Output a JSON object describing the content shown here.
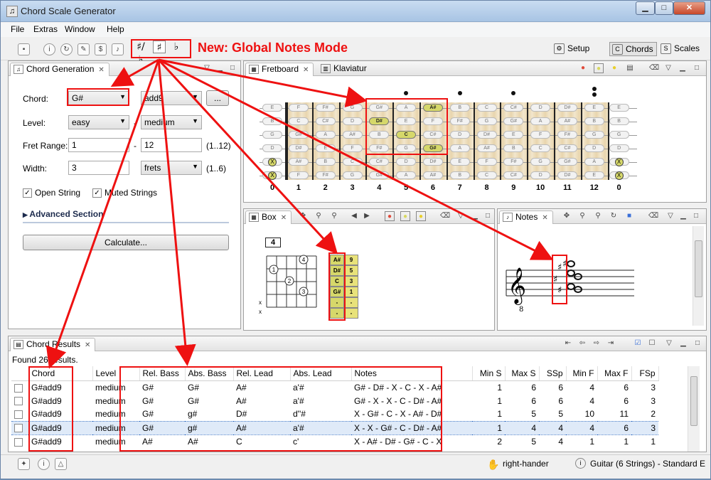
{
  "window": {
    "title": "Chord Scale Generator"
  },
  "menu": [
    "File",
    "Extras",
    "Window",
    "Help"
  ],
  "toolbar": {
    "notes_mode": {
      "sharp_flat": "♯/♭",
      "sharp": "♯",
      "flat": "♭",
      "active": "sharp"
    },
    "annotation": "New: Global Notes Mode"
  },
  "perspectives": [
    {
      "label": "Setup",
      "icon": "setup-icon",
      "active": false
    },
    {
      "label": "Chords",
      "icon": "chords-icon",
      "active": true
    },
    {
      "label": "Scales",
      "icon": "scales-icon",
      "active": false
    }
  ],
  "chord_generation": {
    "tab": "Chord Generation",
    "chord_label": "Chord:",
    "chord_root": "G#",
    "chord_type": "add9",
    "more_button": "...",
    "level_label": "Level:",
    "level_from": "easy",
    "level_dash": "-",
    "level_to": "medium",
    "fret_range_label": "Fret Range:",
    "fret_from": "1",
    "fret_dash": "-",
    "fret_to": "12",
    "fret_hint": "(1..12)",
    "width_label": "Width:",
    "width_value": "3",
    "width_unit": "frets",
    "width_hint": "(1..6)",
    "open_string": "Open String",
    "muted_strings": "Muted Strings",
    "advanced": "Advanced Section",
    "calculate": "Calculate..."
  },
  "fretboard": {
    "tabs": [
      "Fretboard",
      "Klaviatur"
    ],
    "strings": [
      [
        "E",
        "F",
        "F#",
        "G",
        "G#",
        "A",
        "A#",
        "B",
        "C",
        "C#",
        "D",
        "D#",
        "E"
      ],
      [
        "B",
        "C",
        "C#",
        "D",
        "D#",
        "E",
        "F",
        "F#",
        "G",
        "G#",
        "A",
        "A#",
        "B"
      ],
      [
        "G",
        "G#",
        "A",
        "A#",
        "B",
        "C",
        "C#",
        "D",
        "D#",
        "E",
        "F",
        "F#",
        "G"
      ],
      [
        "D",
        "D#",
        "E",
        "F",
        "F#",
        "G",
        "G#",
        "A",
        "A#",
        "B",
        "C",
        "C#",
        "D"
      ],
      [
        "A",
        "A#",
        "B",
        "C",
        "C#",
        "D",
        "D#",
        "E",
        "F",
        "F#",
        "G",
        "G#",
        "A"
      ],
      [
        "E",
        "F",
        "F#",
        "G",
        "G#",
        "A",
        "A#",
        "B",
        "C",
        "C#",
        "D",
        "D#",
        "E"
      ]
    ],
    "highlighted": [
      {
        "string": 0,
        "fret": 6,
        "note": "A#"
      },
      {
        "string": 1,
        "fret": 4,
        "note": "D#"
      },
      {
        "string": 2,
        "fret": 5,
        "note": "C"
      },
      {
        "string": 3,
        "fret": 6,
        "note": "G#"
      }
    ],
    "open_marks": [
      "X",
      "X"
    ],
    "fret_numbers": [
      "0",
      "1",
      "2",
      "3",
      "4",
      "5",
      "6",
      "7",
      "8",
      "9",
      "10",
      "11",
      "12",
      "0"
    ]
  },
  "box": {
    "tab": "Box",
    "start_fret": "4",
    "finger_labels": [
      "1",
      "2",
      "3",
      "4"
    ],
    "muted": [
      "x",
      "x"
    ],
    "note_table": [
      {
        "note": "A#",
        "interval": "9"
      },
      {
        "note": "D#",
        "interval": "5"
      },
      {
        "note": "C",
        "interval": "3"
      },
      {
        "note": "G#",
        "interval": "1"
      },
      {
        "note": "-",
        "interval": "-"
      },
      {
        "note": "-",
        "interval": "-"
      }
    ]
  },
  "notes_view": {
    "tab": "Notes",
    "clef": "𝄞",
    "clef_sub": "8"
  },
  "results": {
    "tab": "Chord Results",
    "found": "Found 26 results.",
    "columns": [
      "Chord",
      "Level",
      "Rel. Bass",
      "Abs. Bass",
      "Rel. Lead",
      "Abs. Lead",
      "Notes",
      "Min S",
      "Max S",
      "SSp",
      "Min F",
      "Max F",
      "FSp"
    ],
    "rows": [
      [
        "G#add9",
        "medium",
        "G#",
        "G#",
        "A#",
        "a'#",
        "G# - D# - X - C - X - A#",
        "1",
        "6",
        "6",
        "4",
        "6",
        "3"
      ],
      [
        "G#add9",
        "medium",
        "G#",
        "G#",
        "A#",
        "a'#",
        "G# - X - X - C - D# - A#",
        "1",
        "6",
        "6",
        "4",
        "6",
        "3"
      ],
      [
        "G#add9",
        "medium",
        "G#",
        "g#",
        "D#",
        "d''#",
        "X - G# - C - X - A# - D#",
        "1",
        "5",
        "5",
        "10",
        "11",
        "2"
      ],
      [
        "G#add9",
        "medium",
        "G#",
        "g#",
        "A#",
        "a'#",
        "X - X - G# - C - D# - A#",
        "1",
        "4",
        "4",
        "4",
        "6",
        "3"
      ],
      [
        "G#add9",
        "medium",
        "A#",
        "A#",
        "C",
        "c'",
        "X - A# - D# - G# - C - X",
        "2",
        "5",
        "4",
        "1",
        "1",
        "1"
      ]
    ],
    "selected_row": 3
  },
  "status": {
    "handedness": "right-hander",
    "instrument": "Guitar (6 Strings) - Standard E"
  },
  "colors": {
    "accent_red": "#ee1111",
    "highlight_note": "#d6d86a"
  }
}
